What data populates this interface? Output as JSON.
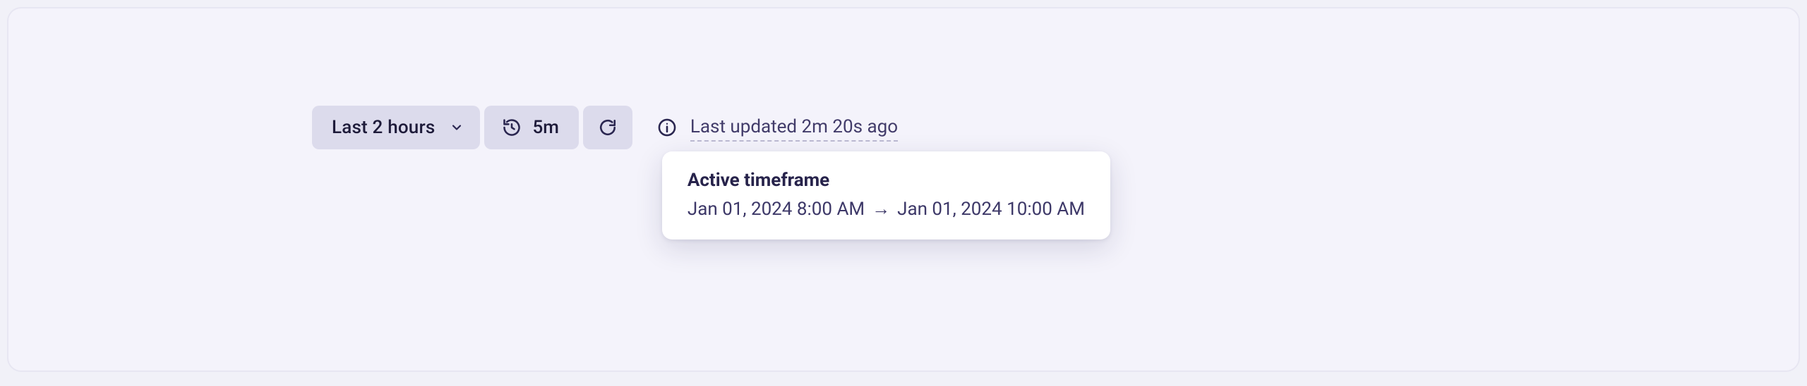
{
  "toolbar": {
    "time_range_label": "Last 2 hours",
    "refresh_interval_label": "5m"
  },
  "status": {
    "last_updated_text": "Last updated 2m 20s ago"
  },
  "tooltip": {
    "title": "Active timeframe",
    "from": "Jan 01, 2024 8:00 AM",
    "arrow": "→",
    "to": "Jan 01, 2024 10:00 AM"
  },
  "colors": {
    "text_primary": "#1e1b3a",
    "text_secondary": "#423c6a",
    "pill_bg": "#dcdbec",
    "surface_bg": "#f4f3fb",
    "border": "#e7e6f2",
    "dash": "#bdbad3"
  }
}
